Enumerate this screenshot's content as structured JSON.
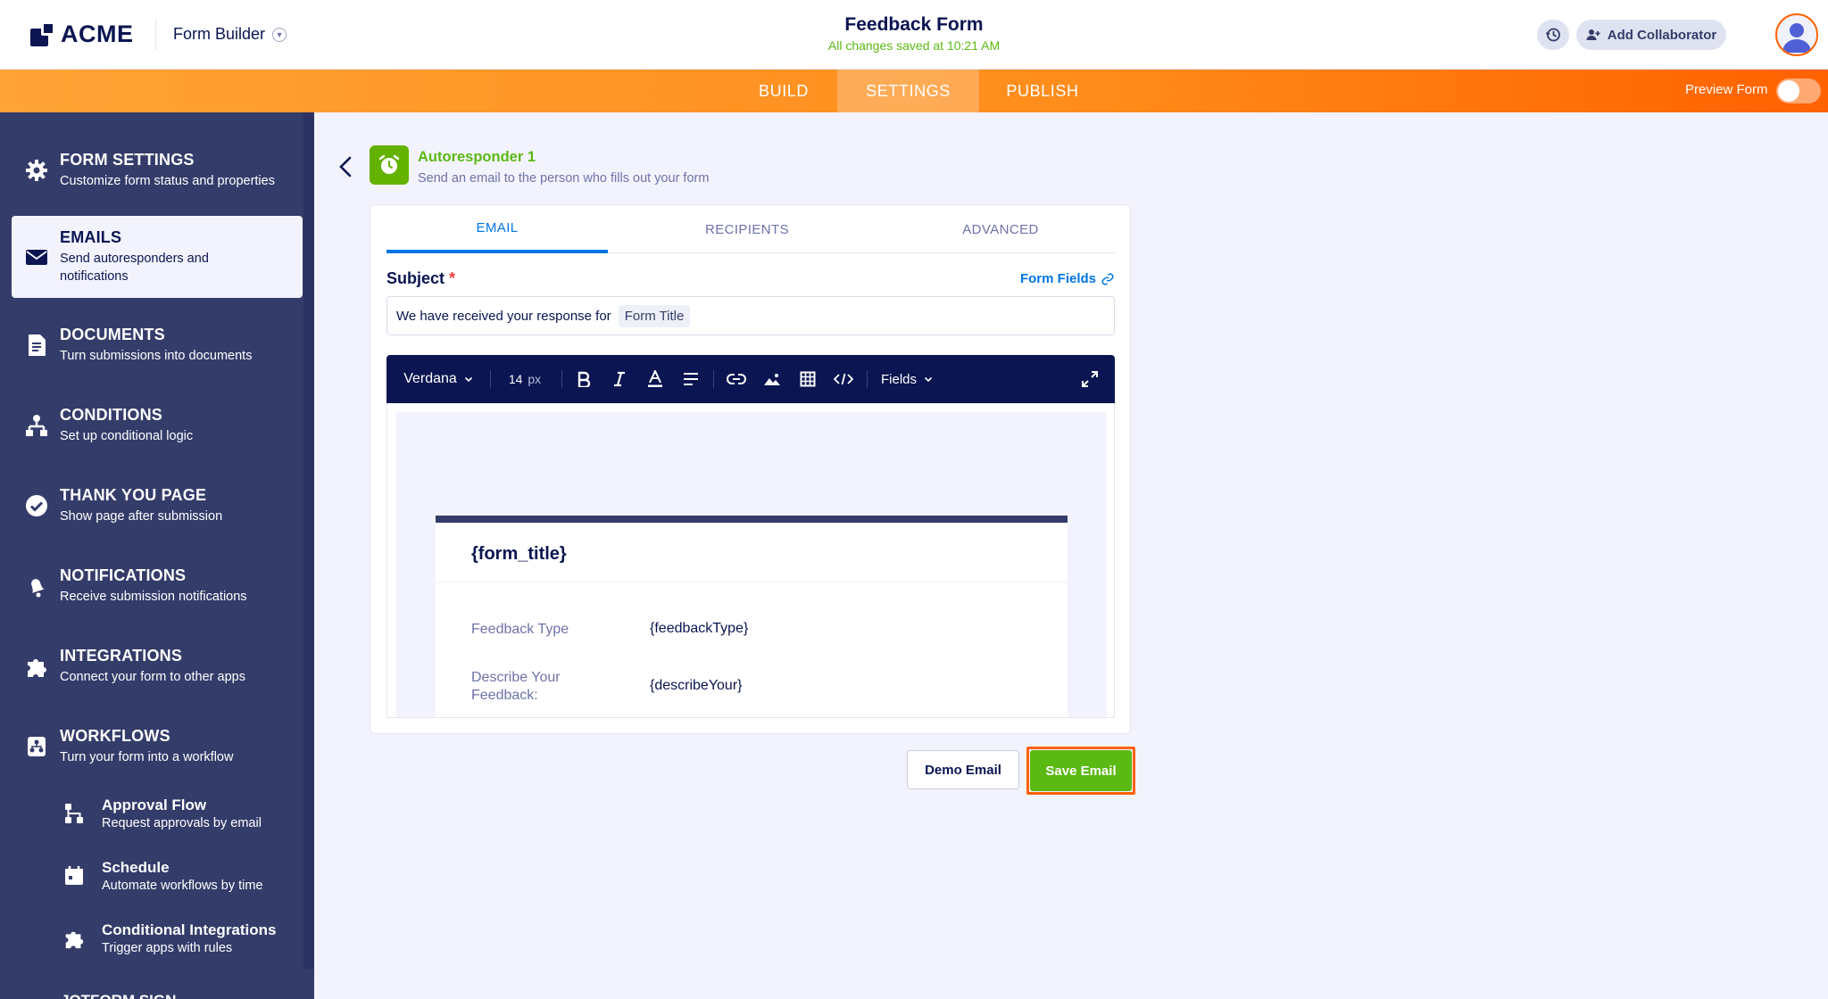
{
  "header": {
    "logo_text": "ACME",
    "product_name": "Form Builder",
    "form_title": "Feedback Form",
    "save_status": "All changes saved at 10:21 AM",
    "add_collaborator_label": "Add Collaborator"
  },
  "nav": {
    "tabs": [
      {
        "label": "BUILD",
        "active": false
      },
      {
        "label": "SETTINGS",
        "active": true
      },
      {
        "label": "PUBLISH",
        "active": false
      }
    ],
    "preview_label": "Preview Form",
    "preview_on": false
  },
  "sidebar": {
    "items": [
      {
        "title": "FORM SETTINGS",
        "desc": "Customize form status and properties",
        "icon": "gear-icon"
      },
      {
        "title": "EMAILS",
        "desc": "Send autoresponders and notifications",
        "icon": "envelope-icon",
        "active": true
      },
      {
        "title": "DOCUMENTS",
        "desc": "Turn submissions into documents",
        "icon": "document-icon"
      },
      {
        "title": "CONDITIONS",
        "desc": "Set up conditional logic",
        "icon": "conditions-icon"
      },
      {
        "title": "THANK YOU PAGE",
        "desc": "Show page after submission",
        "icon": "check-circle-icon"
      },
      {
        "title": "NOTIFICATIONS",
        "desc": "Receive submission notifications",
        "icon": "bell-icon"
      },
      {
        "title": "INTEGRATIONS",
        "desc": "Connect your form to other apps",
        "icon": "puzzle-icon"
      },
      {
        "title": "WORKFLOWS",
        "desc": "Turn your form into a workflow",
        "icon": "workflow-icon"
      }
    ],
    "sub_items": [
      {
        "title": "Approval Flow",
        "desc": "Request approvals by email",
        "icon": "approval-flow-icon"
      },
      {
        "title": "Schedule",
        "desc": "Automate workflows by time",
        "icon": "calendar-icon"
      },
      {
        "title": "Conditional Integrations",
        "desc": "Trigger apps with rules",
        "icon": "puzzle-icon"
      }
    ],
    "cut_off_item": "JOTFORM SIGN"
  },
  "autoresponder": {
    "title": "Autoresponder 1",
    "desc": "Send an email to the person who fills out your form"
  },
  "email_tabs": [
    {
      "label": "EMAIL",
      "active": true
    },
    {
      "label": "RECIPIENTS",
      "active": false
    },
    {
      "label": "ADVANCED",
      "active": false
    }
  ],
  "subject": {
    "label": "Subject",
    "required_mark": "*",
    "form_fields_link": "Form Fields",
    "value_text": "We have received your response for",
    "value_chip": "Form Title"
  },
  "toolbar": {
    "font": "Verdana",
    "size": "14",
    "size_unit": "px",
    "fields_label": "Fields"
  },
  "email_body": {
    "form_title_placeholder": "{form_title}",
    "rows": [
      {
        "label": "Feedback Type",
        "value": "{feedbackType}"
      },
      {
        "label": "Describe Your Feedback:",
        "value": "{describeYour}"
      }
    ]
  },
  "actions": {
    "demo_label": "Demo Email",
    "save_label": "Save Email"
  },
  "colors": {
    "brand_navy": "#0a1551",
    "accent_orange": "#ff6100",
    "success_green": "#5bb913",
    "link_blue": "#0075e3",
    "sidebar_bg": "#343c6a"
  }
}
